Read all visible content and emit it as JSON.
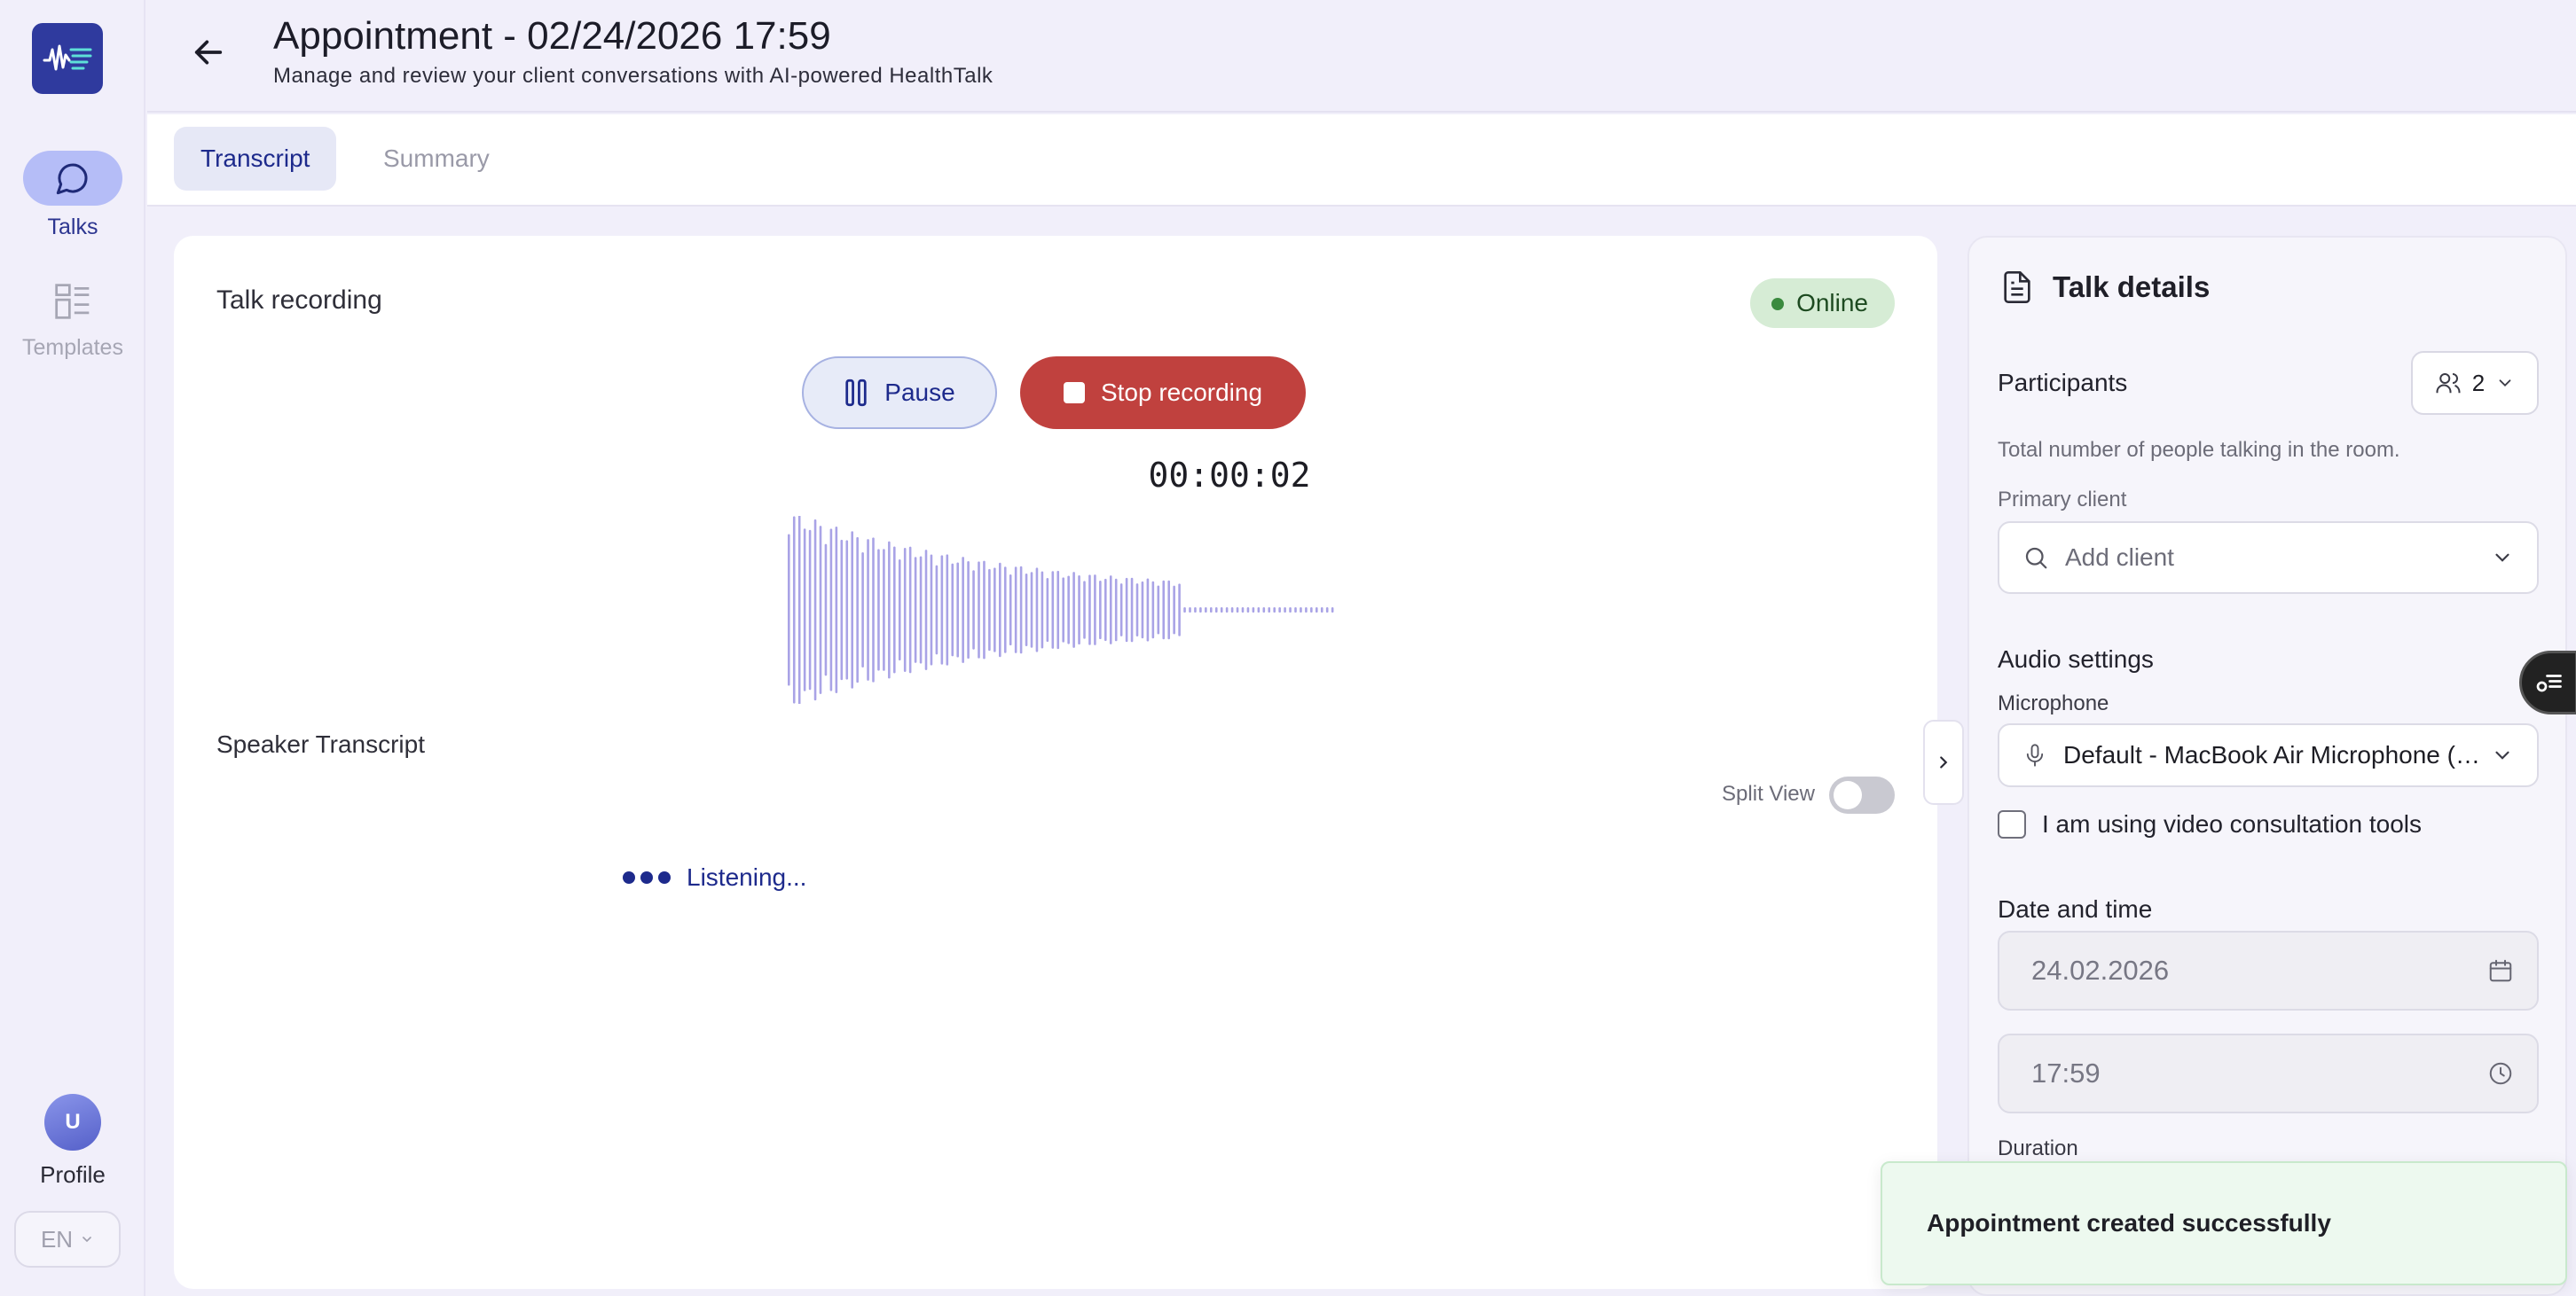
{
  "sidebar": {
    "items": [
      {
        "label": "Talks",
        "icon": "chat-bubble-icon",
        "active": true
      },
      {
        "label": "Templates",
        "icon": "templates-grid-icon",
        "active": false
      }
    ],
    "profile": {
      "initial": "U",
      "label": "Profile"
    },
    "language": "EN"
  },
  "header": {
    "title": "Appointment - 02/24/2026 17:59",
    "subtitle": "Manage and review your client conversations with AI-powered HealthTalk"
  },
  "tabs": [
    {
      "label": "Transcript",
      "active": true
    },
    {
      "label": "Summary",
      "active": false
    }
  ],
  "recording": {
    "title": "Talk recording",
    "status": "Online",
    "pause_label": "Pause",
    "stop_label": "Stop recording",
    "timer": "00:00:02"
  },
  "transcript": {
    "title": "Speaker Transcript",
    "split_view_label": "Split View",
    "split_view_on": false,
    "listening_label": "Listening..."
  },
  "details": {
    "title": "Talk details",
    "participants_label": "Participants",
    "participants_count": "2",
    "participants_help": "Total number of people talking in the room.",
    "primary_client_label": "Primary client",
    "primary_client_placeholder": "Add client",
    "audio_settings_label": "Audio settings",
    "microphone_label": "Microphone",
    "microphone_value": "Default - MacBook Air Microphone (Built-in)",
    "video_tools_label": "I am using video consultation tools",
    "date_time_label": "Date and time",
    "date_value": "24.02.2026",
    "time_value": "17:59",
    "duration_label": "Duration"
  },
  "toast": {
    "message": "Appointment created successfully"
  },
  "colors": {
    "accent": "#1d2a8c",
    "stop": "#c0413e",
    "online_bg": "#d6ecd5",
    "waveform": "#a9a3e6"
  }
}
